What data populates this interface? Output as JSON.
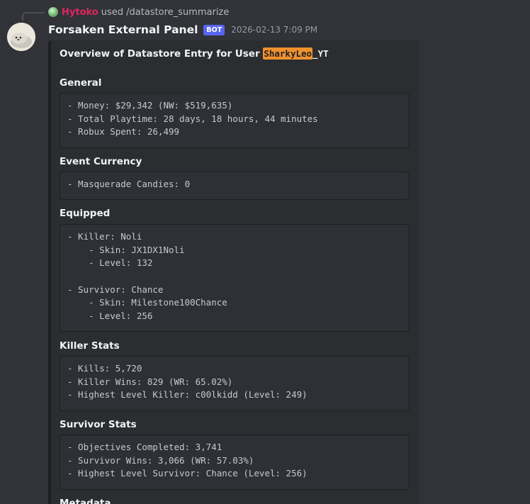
{
  "reply": {
    "user": "Hytoko",
    "command": "used /datastore_summarize"
  },
  "message": {
    "author": "Forsaken External Panel",
    "bot_tag": "BOT",
    "timestamp": "2026-02-13 7:09 PM"
  },
  "embed": {
    "title_prefix": "Overview of Datastore Entry for User ",
    "title_user_highlight": "SharkyLeo",
    "title_user_suffix": "_YT",
    "sections": [
      {
        "heading": "General",
        "lines": [
          "- Money: $29,342 (NW: $519,635)",
          "- Total Playtime: 28 days, 18 hours, 44 minutes",
          "- Robux Spent: 26,499"
        ]
      },
      {
        "heading": "Event Currency",
        "lines": [
          "- Masquerade Candies: 0"
        ]
      },
      {
        "heading": "Equipped",
        "lines": [
          "- Killer: Noli",
          "    - Skin: JX1DX1Noli",
          "    - Level: 132",
          "",
          "- Survivor: Chance",
          "    - Skin: Milestone100Chance",
          "    - Level: 256"
        ]
      },
      {
        "heading": "Killer Stats",
        "lines": [
          "- Kills: 5,720",
          "- Killer Wins: 829 (WR: 65.02%)",
          "- Highest Level Killer: c00lkidd (Level: 249)"
        ]
      },
      {
        "heading": "Survivor Stats",
        "lines": [
          "- Objectives Completed: 3,741",
          "- Survivor Wins: 3,066 (WR: 57.03%)",
          "- Highest Level Survivor: Chance (Level: 256)"
        ]
      },
      {
        "heading": "Metadata",
        "lines": []
      }
    ]
  },
  "colors": {
    "background": "#323339",
    "embed_background": "#2b2d31",
    "bot_tag": "#5865f2",
    "highlight": "#f0912e",
    "reply_user": "#e0245e"
  },
  "icons": {
    "reply_avatar": "user-avatar-icon",
    "bot_avatar": "seal-avatar-icon"
  }
}
